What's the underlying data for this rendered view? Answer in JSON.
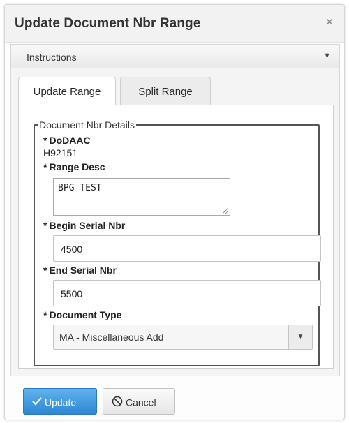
{
  "dialog": {
    "title": "Update Document Nbr Range",
    "close_glyph": "×"
  },
  "instructions": {
    "label": "Instructions",
    "caret_glyph": "▼"
  },
  "tabs": [
    {
      "label": "Update Range",
      "active": true
    },
    {
      "label": "Split Range",
      "active": false
    }
  ],
  "fieldset": {
    "legend": "Document Nbr Details",
    "required_marker": "*",
    "dodaac": {
      "label": "DoDAAC",
      "value": "H92151"
    },
    "range_desc": {
      "label": "Range Desc",
      "value": "BPG TEST"
    },
    "begin_serial": {
      "label": "Begin Serial Nbr",
      "value": "4500"
    },
    "end_serial": {
      "label": "End Serial Nbr",
      "value": "5500"
    },
    "document_type": {
      "label": "Document Type",
      "value": "MA - Miscellaneous Add",
      "caret_glyph": "▼"
    }
  },
  "footer": {
    "update_label": "Update",
    "cancel_label": "Cancel"
  },
  "icons": {
    "close": "close-icon",
    "caret": "chevron-down-icon",
    "update": "checkmark-icon",
    "cancel": "cancel-circle-icon"
  },
  "colors": {
    "update_button": "#2f86d3",
    "legend_border": "#555555"
  }
}
